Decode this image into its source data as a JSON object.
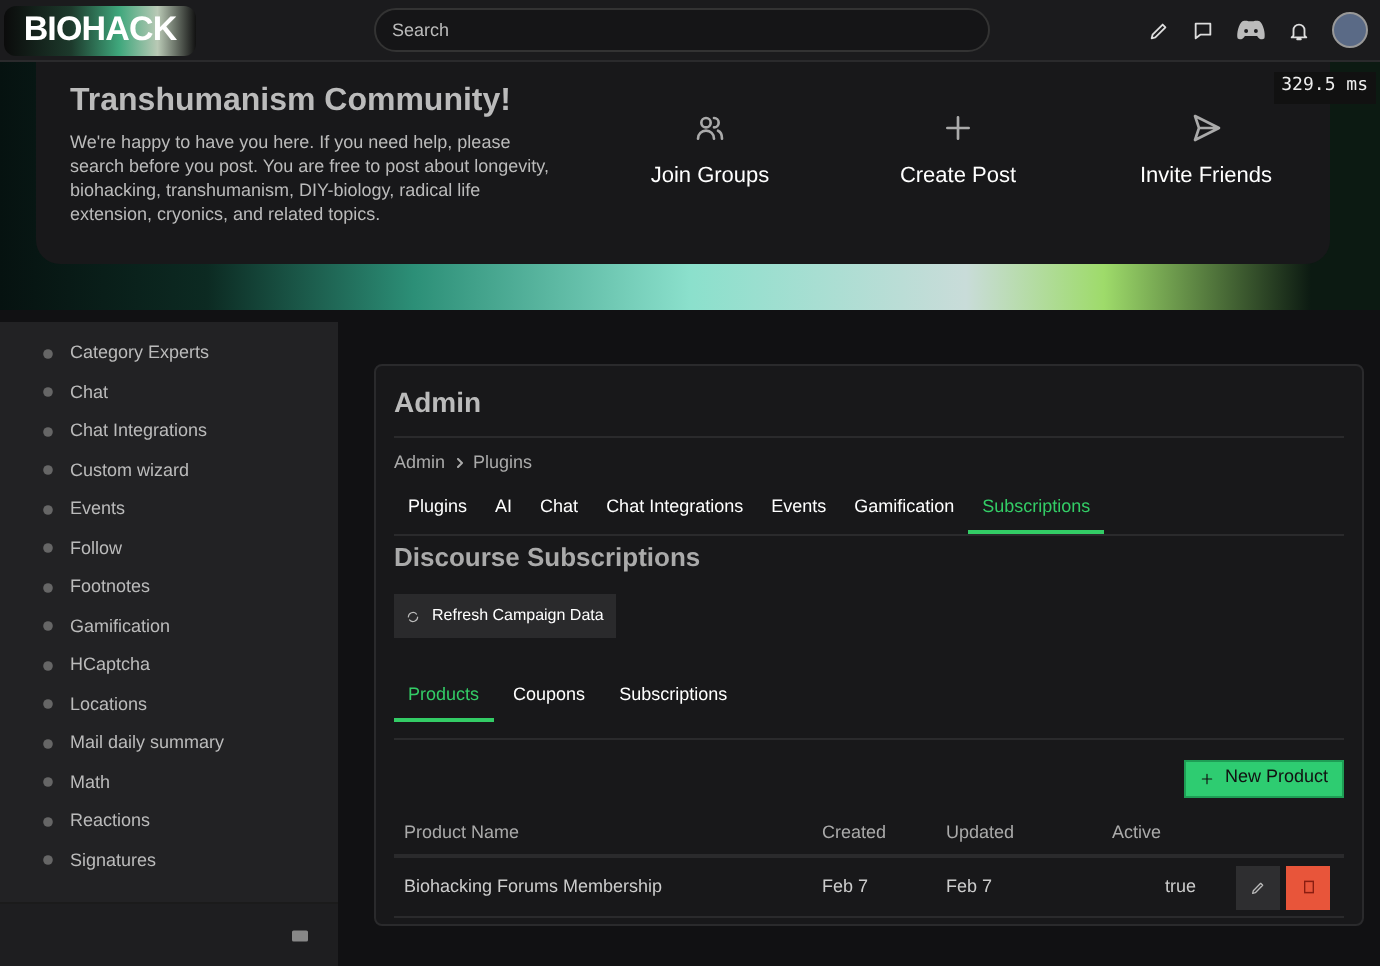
{
  "header": {
    "logo": "BIOHACK",
    "search": {
      "placeholder": "Search"
    },
    "timing_badge": "329.5 ms"
  },
  "welcome": {
    "title": "Transhumanism Community!",
    "text": "We're happy to have you here. If you need help, please search before you post. You are free to post about longevity, biohacking, transhumanism, DIY-biology, radical life extension, cryonics, and related topics.",
    "actions": [
      {
        "kind": "groups",
        "label": "Join Groups"
      },
      {
        "kind": "plus",
        "label": "Create Post"
      },
      {
        "kind": "send",
        "label": "Invite Friends"
      }
    ]
  },
  "sidebar": {
    "items": [
      "Category Experts",
      "Chat",
      "Chat Integrations",
      "Custom wizard",
      "Events",
      "Follow",
      "Footnotes",
      "Gamification",
      "HCaptcha",
      "Locations",
      "Mail daily summary",
      "Math",
      "Reactions",
      "Signatures"
    ]
  },
  "admin": {
    "title": "Admin",
    "breadcrumb": [
      "Admin",
      "Plugins"
    ],
    "tabs": [
      {
        "label": "Plugins",
        "selected": false
      },
      {
        "label": "AI",
        "selected": false
      },
      {
        "label": "Chat",
        "selected": false
      },
      {
        "label": "Chat Integrations",
        "selected": false
      },
      {
        "label": "Events",
        "selected": false
      },
      {
        "label": "Gamification",
        "selected": false
      },
      {
        "label": "Subscriptions",
        "selected": true
      }
    ],
    "section_title": "Discourse Subscriptions",
    "refresh_button": "Refresh Campaign Data",
    "subtabs": [
      {
        "label": "Products",
        "selected": true
      },
      {
        "label": "Coupons",
        "selected": false
      },
      {
        "label": "Subscriptions",
        "selected": false
      }
    ],
    "new_button": "New Product",
    "table": {
      "columns": [
        "Product Name",
        "Created",
        "Updated",
        "Active"
      ],
      "rows": [
        [
          "Biohacking Forums Membership",
          "Feb 7",
          "Feb 7",
          "true"
        ]
      ]
    }
  }
}
